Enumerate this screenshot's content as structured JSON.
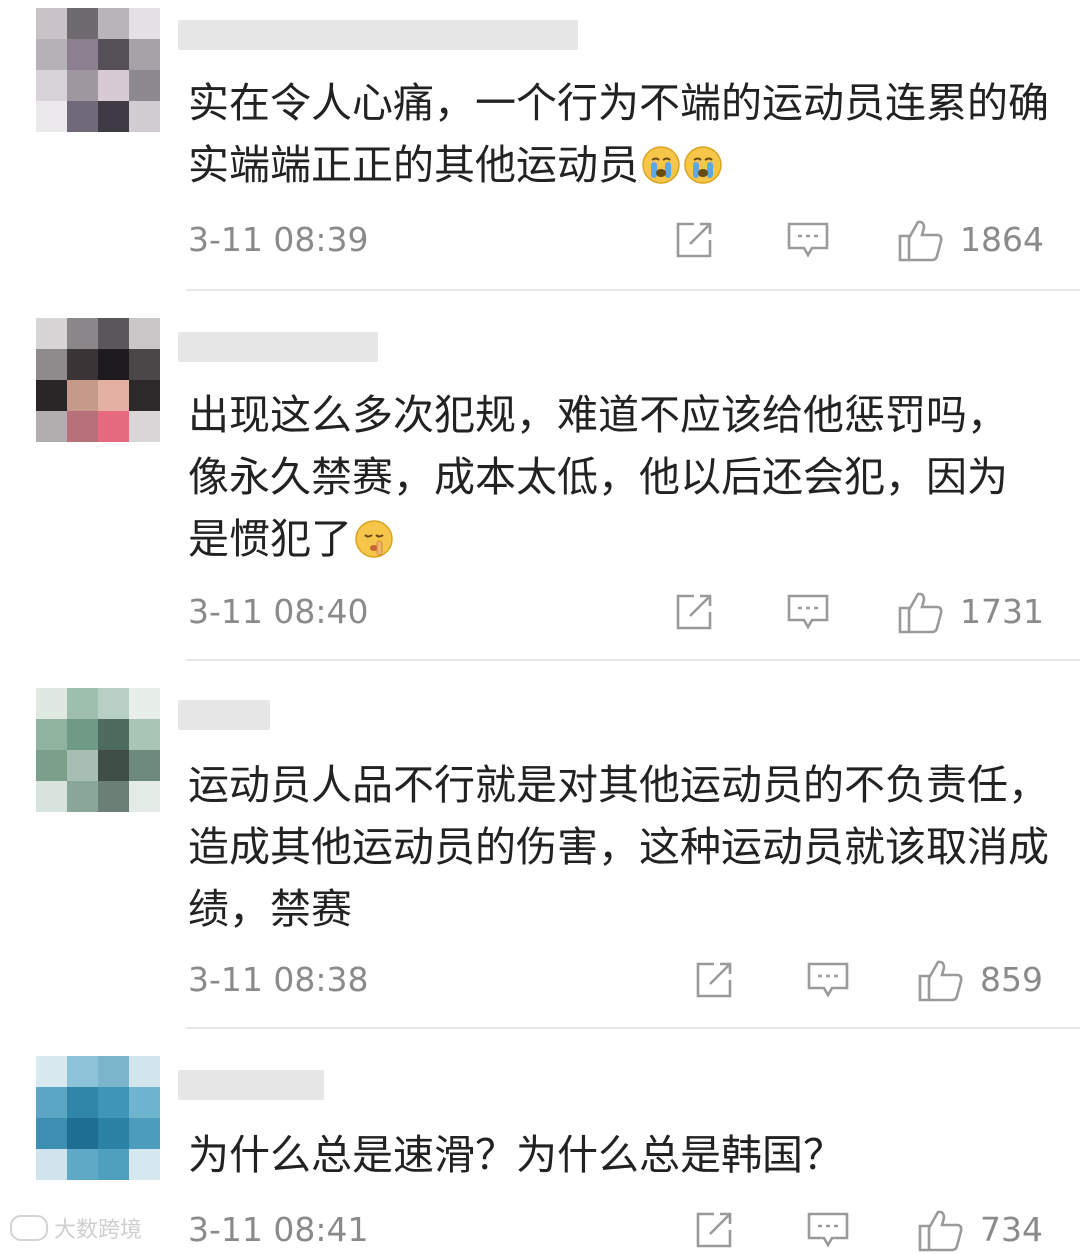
{
  "comments": [
    {
      "text": "实在令人心痛，一个行为不端的运动员连累的确实端端正正的其他运动员",
      "emoji": [
        "crying-face",
        "crying-face"
      ],
      "timestamp": "3-11 08:39",
      "likes": "1864"
    },
    {
      "text": "出现这么多次犯规，难道不应该给他惩罚吗，像永久禁赛，成本太低，他以后还会犯，因为是惯犯了",
      "emoji": [
        "shushing-face"
      ],
      "timestamp": "3-11 08:40",
      "likes": "1731"
    },
    {
      "text": "运动员人品不行就是对其他运动员的不负责任，造成其他运动员的伤害，这种运动员就该取消成绩，禁赛",
      "emoji": [],
      "timestamp": "3-11 08:38",
      "likes": "859"
    },
    {
      "text": "为什么总是速滑？为什么总是韩国？",
      "emoji": [],
      "timestamp": "3-11 08:41",
      "likes": "734"
    }
  ],
  "watermark": {
    "text": "大数跨境"
  },
  "colors": {
    "text": "#222222",
    "meta": "#8a8a8a",
    "divider": "#e8e8e8",
    "icon": "#9a9a9a"
  }
}
